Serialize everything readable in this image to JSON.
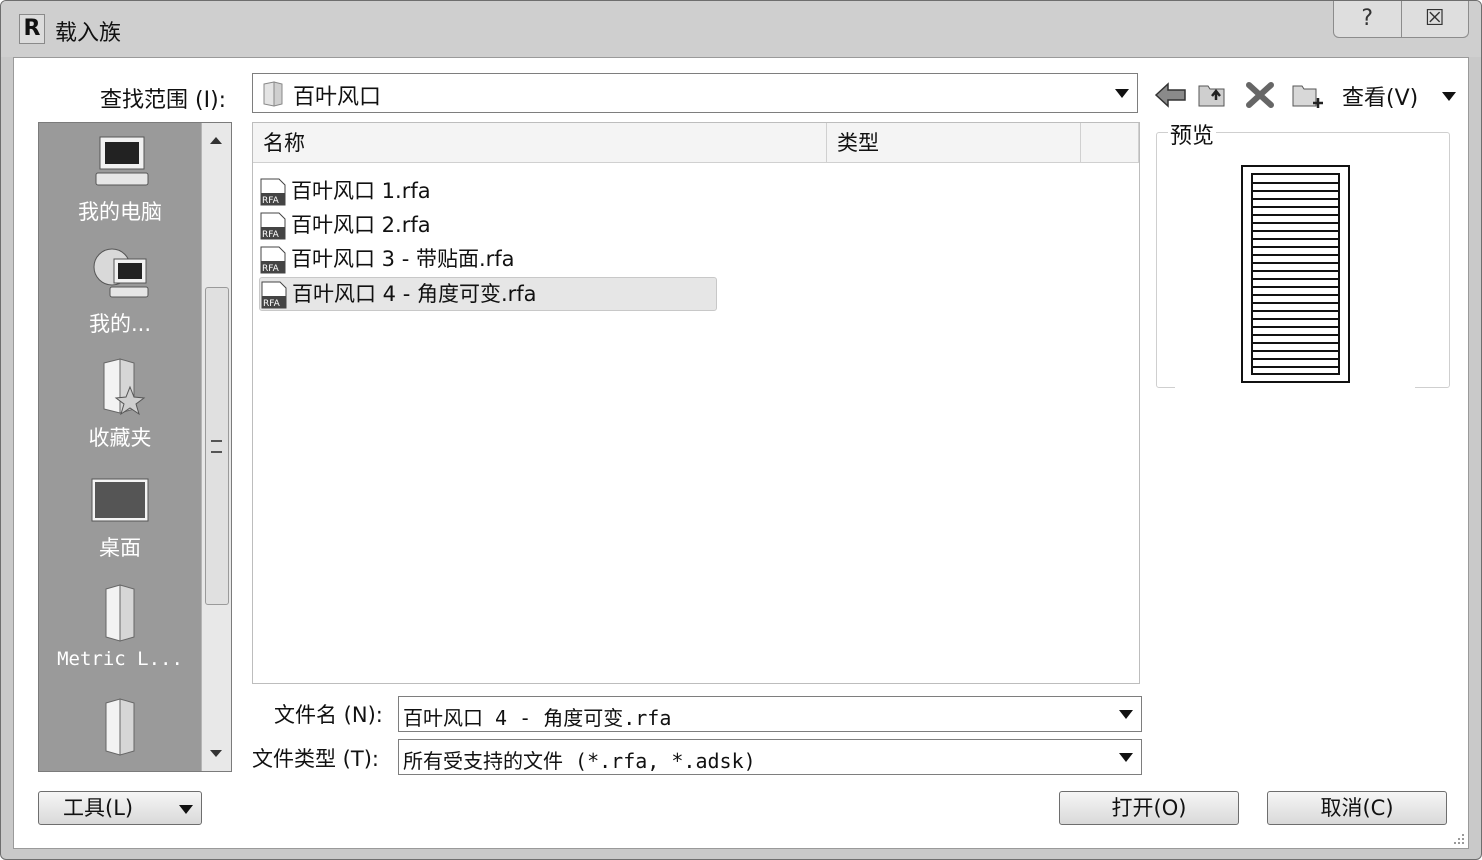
{
  "window": {
    "title": "载入族",
    "help_glyph": "?",
    "close_glyph": "☒"
  },
  "lookin": {
    "label": "查找范围 (I):",
    "value": "百叶风口",
    "view_label": "查看(V)"
  },
  "places": [
    {
      "label": "我的电脑",
      "icon": "computer-icon"
    },
    {
      "label": "我的...",
      "icon": "network-computer-icon"
    },
    {
      "label": "收藏夹",
      "icon": "favorites-folder-icon"
    },
    {
      "label": "桌面",
      "icon": "desktop-icon"
    },
    {
      "label": "Metric L...",
      "icon": "folder-icon"
    },
    {
      "label": "",
      "icon": "folder-icon"
    }
  ],
  "columns": {
    "name": "名称",
    "type": "类型"
  },
  "files": [
    {
      "name": "百叶风口 1.rfa",
      "selected": false
    },
    {
      "name": "百叶风口 2.rfa",
      "selected": false
    },
    {
      "name": "百叶风口 3 - 带贴面.rfa",
      "selected": false
    },
    {
      "name": "百叶风口 4 - 角度可变.rfa",
      "selected": true
    }
  ],
  "filename": {
    "label": "文件名 (N):",
    "value": "百叶风口 4 - 角度可变.rfa"
  },
  "filetype": {
    "label": "文件类型 (T):",
    "value": "所有受支持的文件 (*.rfa, *.adsk)"
  },
  "preview": {
    "label": "预览"
  },
  "buttons": {
    "tools": "工具(L)",
    "open": "打开(O)",
    "cancel": "取消(C)"
  }
}
